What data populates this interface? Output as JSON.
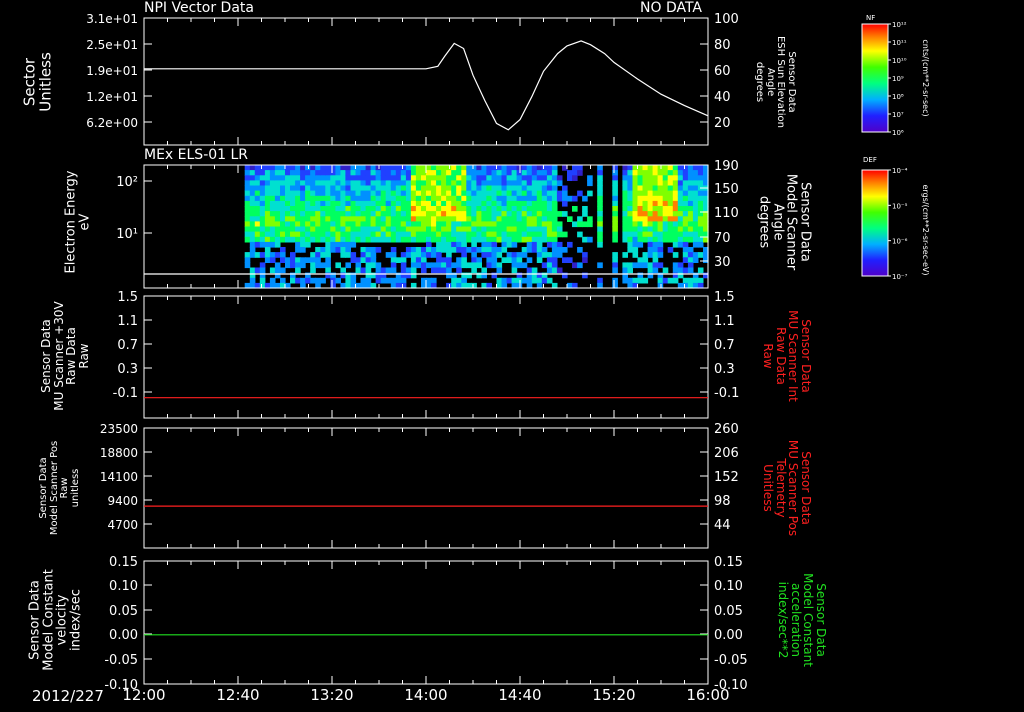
{
  "colors": {
    "background": "#000000",
    "axis": "#ffffff",
    "red": "#ff2020",
    "green": "#20e020"
  },
  "date_label": "2012/227",
  "time_ticks": [
    "12:00",
    "12:40",
    "13:20",
    "14:00",
    "14:40",
    "15:20",
    "16:00"
  ],
  "chart_data": [
    {
      "type": "line",
      "panel": "npi-vector",
      "title": "NPI Vector Data",
      "status": "NO DATA",
      "left_axis": {
        "label_lines": [
          "Sector",
          "Unitless"
        ],
        "ticks": [
          "3.1e+01",
          "2.5e+01",
          "1.9e+01",
          "1.2e+01",
          "6.2e+00"
        ]
      },
      "right_axis": {
        "label_lines": [
          "Sensor Data",
          "ESH Sun Elevation",
          "Angle",
          "degrees"
        ],
        "ticks": [
          "100",
          "80",
          "60",
          "40",
          "20"
        ],
        "ylim": [
          0,
          100
        ]
      },
      "colorbar": {
        "tag": "NF",
        "unit": "cnts/(cm**2-sr-sec)",
        "ticks": [
          "10¹²",
          "10¹¹",
          "10¹⁰",
          "10⁹",
          "10⁸",
          "10⁷",
          "10⁶"
        ]
      },
      "series": [
        {
          "x_min": [
            0,
            10,
            20,
            30,
            40,
            50,
            60,
            70,
            80,
            90,
            100,
            110,
            120,
            125,
            128,
            132,
            136,
            140,
            145,
            150,
            155,
            160,
            165,
            170,
            176,
            180,
            186,
            190,
            196,
            200,
            210,
            220,
            230,
            240
          ],
          "y": [
            60,
            60,
            60,
            60,
            60,
            60,
            60,
            60,
            60,
            60,
            60,
            60,
            60,
            62,
            70,
            80,
            76,
            55,
            35,
            17,
            12,
            20,
            38,
            58,
            72,
            78,
            82,
            79,
            72,
            65,
            52,
            40,
            31,
            23
          ]
        }
      ]
    },
    {
      "type": "heatmap",
      "panel": "els-spectrogram",
      "title": "MEx ELS-01 LR",
      "left_axis": {
        "label_lines": [
          "Electron Energy",
          "eV"
        ],
        "ticks": [
          "10²",
          "10¹"
        ]
      },
      "right_axis": {
        "label_lines": [
          "Sensor Data",
          "Model Scanner",
          "Angle",
          "degrees"
        ],
        "ticks": [
          "190",
          "150",
          "110",
          "70",
          "30"
        ],
        "ylim": [
          0,
          190
        ]
      },
      "colorbar": {
        "tag": "DEF",
        "unit": "ergs/(cm**2-sr-sec-eV)",
        "ticks": [
          "10⁻⁴",
          "10⁻⁵",
          "10⁻⁶",
          "10⁻⁷"
        ]
      },
      "line_value": 10
    },
    {
      "type": "line",
      "panel": "mu-scanner-raw",
      "left_axis": {
        "label_lines": [
          "Sensor Data",
          "MU Scanner +30V",
          "Raw Data",
          "Raw"
        ],
        "ticks": [
          "1.5",
          "1.1",
          "0.7",
          "0.3",
          "-0.1"
        ],
        "ylim": [
          -0.3,
          1.5
        ]
      },
      "right_axis": {
        "label_lines": [
          "Sensor Data",
          "MU Scanner Int",
          "Raw Data",
          "Raw"
        ],
        "ticks": [
          "1.5",
          "1.1",
          "0.7",
          "0.3",
          "-0.1"
        ]
      },
      "series": [
        {
          "constant": 0.0,
          "color": "#ff2020"
        }
      ]
    },
    {
      "type": "line",
      "panel": "scanner-pos",
      "left_axis": {
        "label_lines": [
          "Sensor Data",
          "Model Scanner Pos",
          "Raw",
          "unitless"
        ],
        "ticks": [
          "23500",
          "18800",
          "14100",
          "9400",
          "4700"
        ],
        "ylim": [
          0,
          23500
        ]
      },
      "right_axis": {
        "label_lines": [
          "Sensor Data",
          "MU Scanner Pos",
          "Telemetry",
          "Unitless"
        ],
        "ticks": [
          "260",
          "206",
          "152",
          "98",
          "44"
        ]
      },
      "series": [
        {
          "constant": 8200,
          "color": "#ff2020"
        }
      ]
    },
    {
      "type": "line",
      "panel": "model-constant",
      "left_axis": {
        "label_lines": [
          "Sensor Data",
          "Model Constant",
          "velocity",
          "index/sec"
        ],
        "ticks": [
          "0.15",
          "0.10",
          "0.05",
          "0.00",
          "-0.05",
          "-0.10"
        ],
        "ylim": [
          -0.1,
          0.15
        ]
      },
      "right_axis": {
        "label_lines": [
          "Sensor Data",
          "Model Constant",
          "acceleration",
          "index/sec**2"
        ],
        "ticks": [
          "0.15",
          "0.10",
          "0.05",
          "0.00",
          "-0.05",
          "-0.10"
        ]
      },
      "series": [
        {
          "constant": 0.0,
          "color": "#20e020"
        }
      ]
    }
  ]
}
